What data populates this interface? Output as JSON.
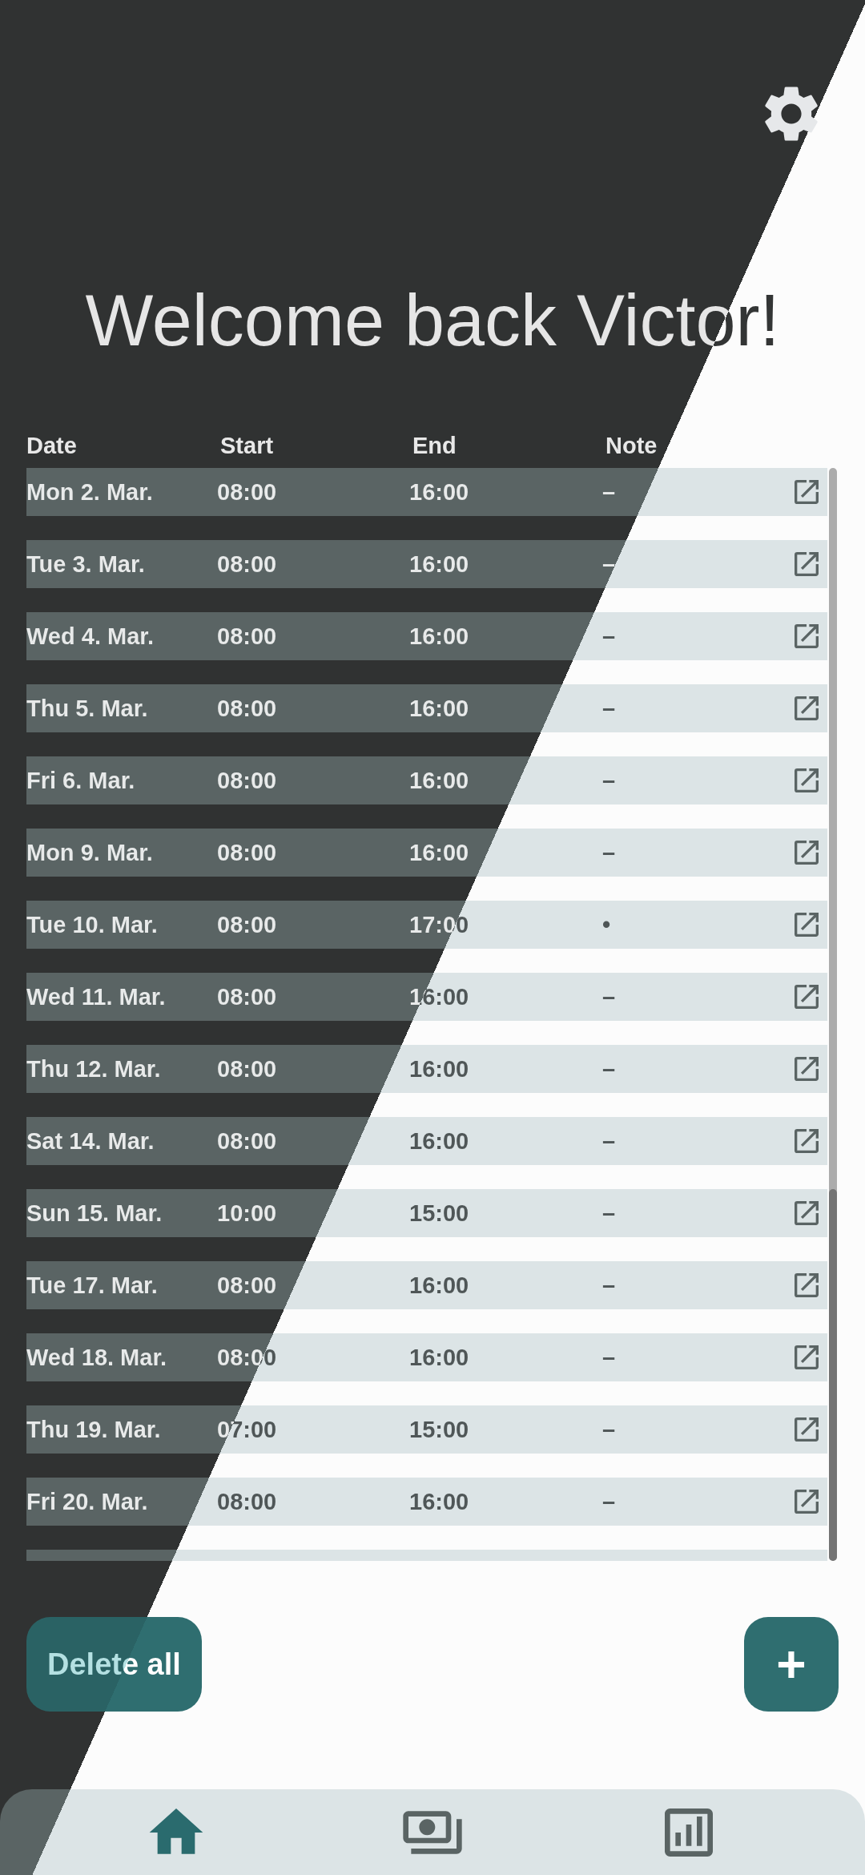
{
  "title": "Welcome back Victor!",
  "columns": [
    "Date",
    "Start",
    "End",
    "Note"
  ],
  "rows": [
    {
      "date": "Mon 2. Mar.",
      "start": "08:00",
      "end": "16:00",
      "note": "–"
    },
    {
      "date": "Tue 3. Mar.",
      "start": "08:00",
      "end": "16:00",
      "note": "–"
    },
    {
      "date": "Wed 4. Mar.",
      "start": "08:00",
      "end": "16:00",
      "note": "–"
    },
    {
      "date": "Thu 5. Mar.",
      "start": "08:00",
      "end": "16:00",
      "note": "–"
    },
    {
      "date": "Fri 6. Mar.",
      "start": "08:00",
      "end": "16:00",
      "note": "–"
    },
    {
      "date": "Mon 9. Mar.",
      "start": "08:00",
      "end": "16:00",
      "note": "–"
    },
    {
      "date": "Tue 10. Mar.",
      "start": "08:00",
      "end": "17:00",
      "note": "•"
    },
    {
      "date": "Wed 11. Mar.",
      "start": "08:00",
      "end": "16:00",
      "note": "–"
    },
    {
      "date": "Thu 12. Mar.",
      "start": "08:00",
      "end": "16:00",
      "note": "–"
    },
    {
      "date": "Sat 14. Mar.",
      "start": "08:00",
      "end": "16:00",
      "note": "–"
    },
    {
      "date": "Sun 15. Mar.",
      "start": "10:00",
      "end": "15:00",
      "note": "–"
    },
    {
      "date": "Tue 17. Mar.",
      "start": "08:00",
      "end": "16:00",
      "note": "–"
    },
    {
      "date": "Wed 18. Mar.",
      "start": "08:00",
      "end": "16:00",
      "note": "–"
    },
    {
      "date": "Thu 19. Mar.",
      "start": "07:00",
      "end": "15:00",
      "note": "–"
    },
    {
      "date": "Fri 20. Mar.",
      "start": "08:00",
      "end": "16:00",
      "note": "–"
    }
  ],
  "delete_button": "Delete all",
  "add_button": "+",
  "nav": [
    {
      "kind": "home",
      "selected": true
    },
    {
      "kind": "money",
      "selected": false
    },
    {
      "kind": "chart",
      "selected": false
    }
  ]
}
